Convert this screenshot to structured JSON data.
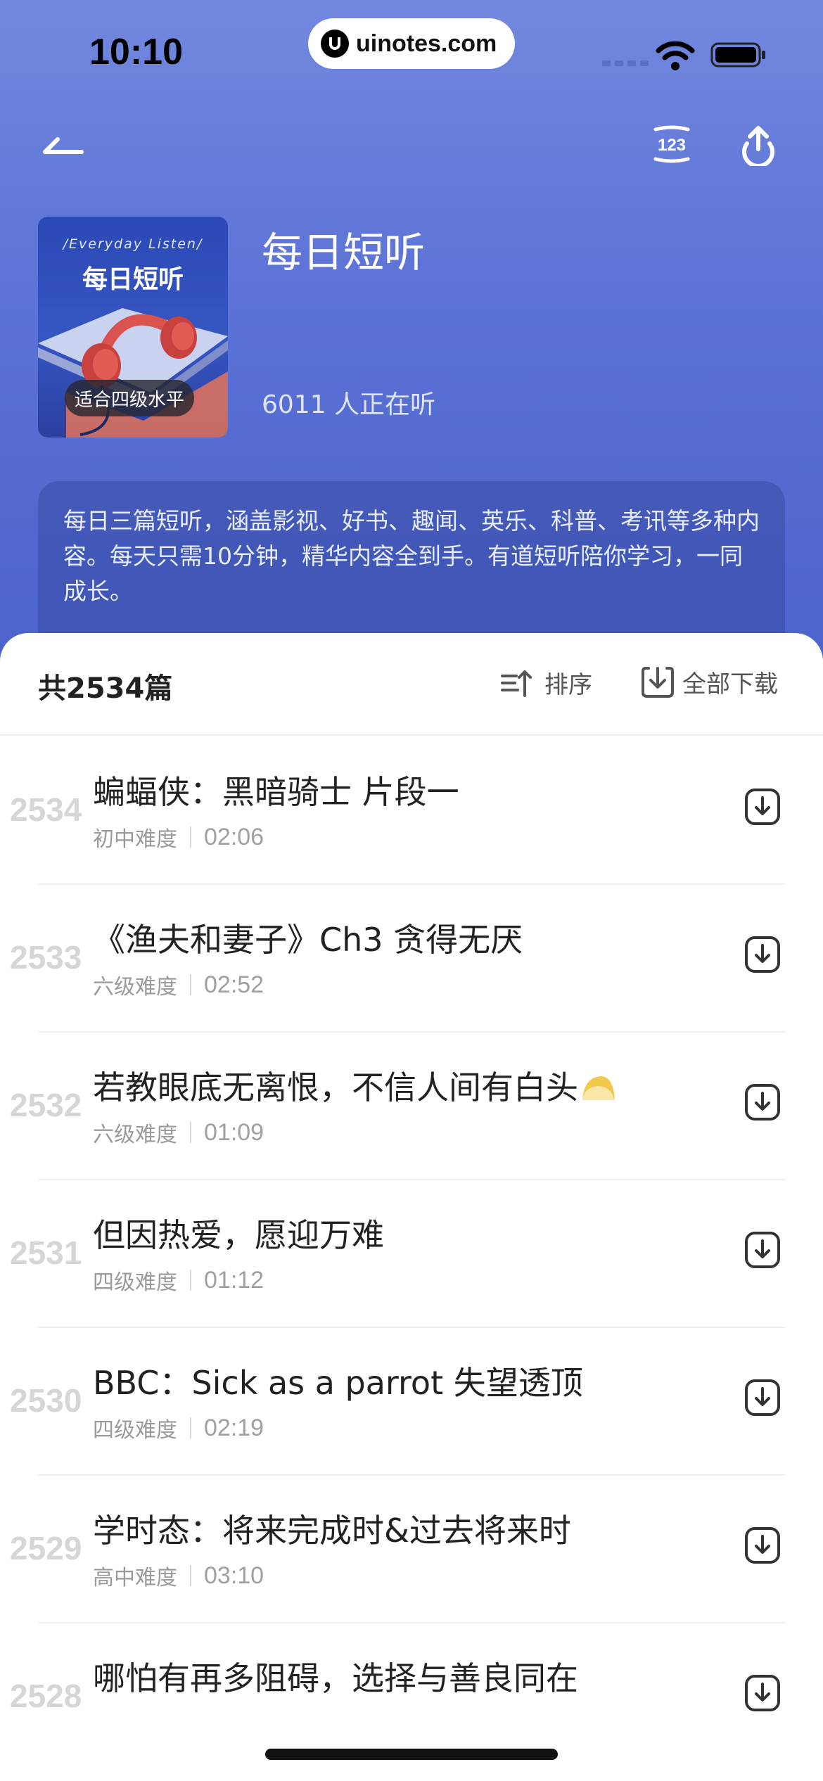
{
  "status_bar": {
    "time": "10:10",
    "url": "uinotes.com"
  },
  "podcast": {
    "cover_en": "/Everyday Listen/",
    "cover_cn": "每日短听",
    "cover_tag": "适合四级水平",
    "title": "每日短听",
    "listeners": "6011 人正在听",
    "description": "每日三篇短听，涵盖影视、好书、趣闻、英乐、科普、考讯等多种内容。每天只需10分钟，精华内容全到手。有道短听陪你学习，一同成长。"
  },
  "list_header": {
    "count": "共2534篇",
    "sort_label": "排序",
    "download_all_label": "全部下载"
  },
  "items": [
    {
      "num": "2534",
      "title": "蝙蝠侠：黑暗骑士 片段一",
      "level": "初中难度",
      "duration": "02:06"
    },
    {
      "num": "2533",
      "title": "《渔夫和妻子》Ch3 贪得无厌",
      "level": "六级难度",
      "duration": "02:52"
    },
    {
      "num": "2532",
      "title": "若教眼底无离恨，不信人间有白头",
      "level": "六级难度",
      "duration": "01:09"
    },
    {
      "num": "2531",
      "title": "但因热爱，愿迎万难",
      "level": "四级难度",
      "duration": "01:12"
    },
    {
      "num": "2530",
      "title": "BBC：Sick as a parrot 失望透顶",
      "level": "四级难度",
      "duration": "02:19"
    },
    {
      "num": "2529",
      "title": "学时态：将来完成时&过去将来时",
      "level": "高中难度",
      "duration": "03:10"
    },
    {
      "num": "2528",
      "title": "哪怕有再多阻碍，选择与善良同在",
      "level": "",
      "duration": ""
    }
  ],
  "colors": {
    "hero_top": "#7388de",
    "hero_bottom": "#4c62cc",
    "text_primary": "#222222",
    "text_muted": "#9a9a9a"
  },
  "icons": [
    "back-arrow-icon",
    "number-123-icon",
    "share-upload-icon",
    "sort-icon",
    "download-all-icon",
    "download-icon",
    "wifi-icon",
    "battery-icon",
    "headphones-art"
  ]
}
